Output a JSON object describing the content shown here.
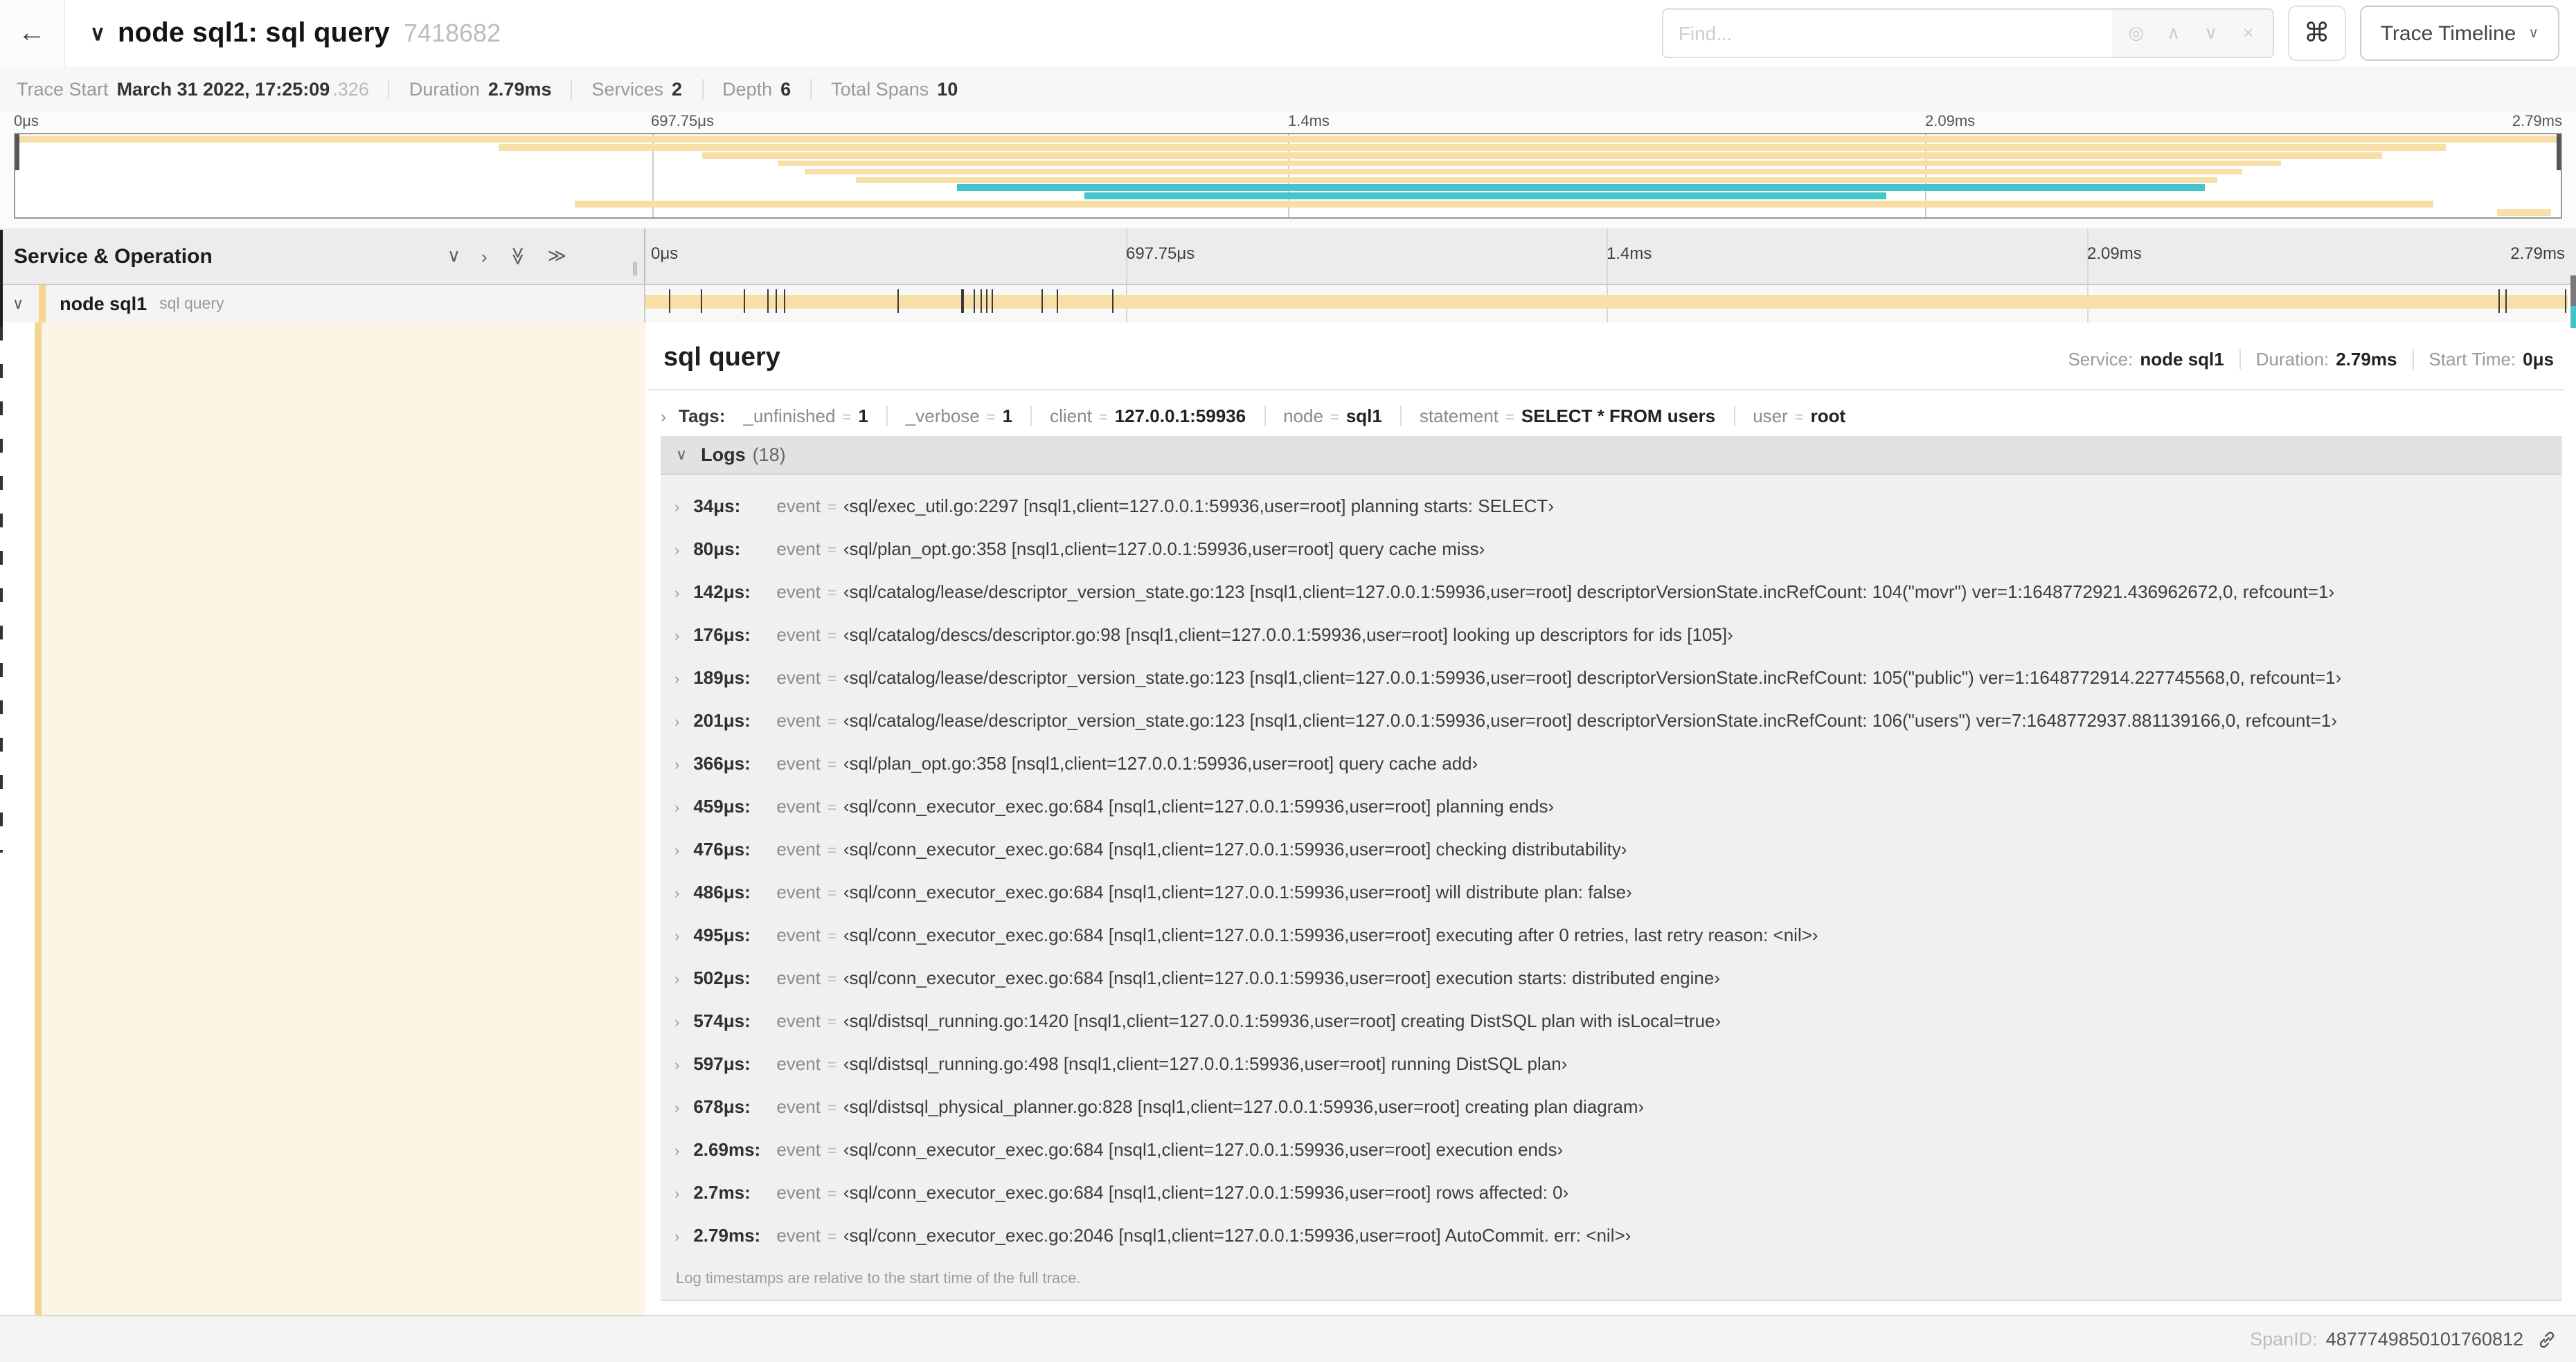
{
  "header": {
    "title": "node sql1: sql query",
    "trace_id": "7418682",
    "find_placeholder": "Find...",
    "view_select_label": "Trace Timeline"
  },
  "icons": {
    "back": "←",
    "title_chevron": "∨",
    "locate": "◎",
    "prev": "∧",
    "next": "∨",
    "clear": "×",
    "command": "⌘",
    "dropdown_chevron": "∨",
    "collapse_one": "∨",
    "expand_one": "›",
    "double_chevron": "≫",
    "row_chevron": "∨",
    "item_chevron": "›",
    "resizer": "∥"
  },
  "trace_info": {
    "items": [
      {
        "label": "Trace Start",
        "value": "March 31 2022, 17:25:09",
        "suffix": ".326"
      },
      {
        "label": "Duration",
        "value": "2.79ms",
        "suffix": ""
      },
      {
        "label": "Services",
        "value": "2",
        "suffix": ""
      },
      {
        "label": "Depth",
        "value": "6",
        "suffix": ""
      },
      {
        "label": "Total Spans",
        "value": "10",
        "suffix": ""
      }
    ]
  },
  "timeline": {
    "ticks": [
      "0μs",
      "697.75μs",
      "1.4ms",
      "2.09ms",
      "2.79ms"
    ],
    "tick_pcts": [
      0,
      25,
      50,
      75,
      100
    ],
    "colors": {
      "tan": "#f7dfa7",
      "teal": "#45c5c9",
      "accent": "#f4d591",
      "cream": "#fcf4e4"
    },
    "minimap_rows": [
      {
        "color": "tan",
        "start": 0,
        "end": 100
      },
      {
        "color": "tan",
        "start": 19,
        "end": 95.5
      },
      {
        "color": "tan",
        "start": 27,
        "end": 93
      },
      {
        "color": "tan",
        "start": 30,
        "end": 89
      },
      {
        "color": "tan",
        "start": 31,
        "end": 87.5
      },
      {
        "color": "tan",
        "start": 33,
        "end": 86.5
      },
      {
        "color": "teal",
        "start": 37,
        "end": 86
      },
      {
        "color": "teal",
        "start": 42,
        "end": 73.5
      },
      {
        "color": "tan",
        "start": 22,
        "end": 95
      },
      {
        "color": "tan",
        "start": 97.5,
        "end": 99.6
      }
    ],
    "span_ticks_pct": [
      1.22,
      2.87,
      5.09,
      6.31,
      6.78,
      7.2,
      13.12,
      16.45,
      17.06,
      17.42,
      17.74,
      17.99,
      20.57,
      21.4,
      24.3,
      96.42,
      96.77,
      99.85
    ]
  },
  "span_list": {
    "header": "Service & Operation",
    "rows": [
      {
        "service": "node sql1",
        "operation": "sql query"
      }
    ]
  },
  "detail": {
    "title": "sql query",
    "meta": [
      {
        "label": "Service:",
        "value": "node sql1"
      },
      {
        "label": "Duration:",
        "value": "2.79ms"
      },
      {
        "label": "Start Time:",
        "value": "0μs"
      }
    ],
    "tags_label": "Tags:",
    "tags": [
      {
        "key": "_unfinished",
        "value": "1"
      },
      {
        "key": "_verbose",
        "value": "1"
      },
      {
        "key": "client",
        "value": "127.0.0.1:59936"
      },
      {
        "key": "node",
        "value": "sql1"
      },
      {
        "key": "statement",
        "value": "SELECT * FROM users"
      },
      {
        "key": "user",
        "value": "root"
      }
    ],
    "logs_label": "Logs",
    "logs_count": "(18)",
    "logs": [
      {
        "time": "34μs:",
        "key": "event",
        "value": "‹sql/exec_util.go:2297 [nsql1,client=127.0.0.1:59936,user=root] planning starts: SELECT›"
      },
      {
        "time": "80μs:",
        "key": "event",
        "value": "‹sql/plan_opt.go:358 [nsql1,client=127.0.0.1:59936,user=root] query cache miss›"
      },
      {
        "time": "142μs:",
        "key": "event",
        "value": "‹sql/catalog/lease/descriptor_version_state.go:123 [nsql1,client=127.0.0.1:59936,user=root] descriptorVersionState.incRefCount: 104(\"movr\") ver=1:1648772921.436962672,0, refcount=1›"
      },
      {
        "time": "176μs:",
        "key": "event",
        "value": "‹sql/catalog/descs/descriptor.go:98 [nsql1,client=127.0.0.1:59936,user=root] looking up descriptors for ids [105]›"
      },
      {
        "time": "189μs:",
        "key": "event",
        "value": "‹sql/catalog/lease/descriptor_version_state.go:123 [nsql1,client=127.0.0.1:59936,user=root] descriptorVersionState.incRefCount: 105(\"public\") ver=1:1648772914.227745568,0, refcount=1›"
      },
      {
        "time": "201μs:",
        "key": "event",
        "value": "‹sql/catalog/lease/descriptor_version_state.go:123 [nsql1,client=127.0.0.1:59936,user=root] descriptorVersionState.incRefCount: 106(\"users\") ver=7:1648772937.881139166,0, refcount=1›"
      },
      {
        "time": "366μs:",
        "key": "event",
        "value": "‹sql/plan_opt.go:358 [nsql1,client=127.0.0.1:59936,user=root] query cache add›"
      },
      {
        "time": "459μs:",
        "key": "event",
        "value": "‹sql/conn_executor_exec.go:684 [nsql1,client=127.0.0.1:59936,user=root] planning ends›"
      },
      {
        "time": "476μs:",
        "key": "event",
        "value": "‹sql/conn_executor_exec.go:684 [nsql1,client=127.0.0.1:59936,user=root] checking distributability›"
      },
      {
        "time": "486μs:",
        "key": "event",
        "value": "‹sql/conn_executor_exec.go:684 [nsql1,client=127.0.0.1:59936,user=root] will distribute plan: false›"
      },
      {
        "time": "495μs:",
        "key": "event",
        "value": "‹sql/conn_executor_exec.go:684 [nsql1,client=127.0.0.1:59936,user=root] executing after 0 retries, last retry reason: <nil>›"
      },
      {
        "time": "502μs:",
        "key": "event",
        "value": "‹sql/conn_executor_exec.go:684 [nsql1,client=127.0.0.1:59936,user=root] execution starts: distributed engine›"
      },
      {
        "time": "574μs:",
        "key": "event",
        "value": "‹sql/distsql_running.go:1420 [nsql1,client=127.0.0.1:59936,user=root] creating DistSQL plan with isLocal=true›"
      },
      {
        "time": "597μs:",
        "key": "event",
        "value": "‹sql/distsql_running.go:498 [nsql1,client=127.0.0.1:59936,user=root] running DistSQL plan›"
      },
      {
        "time": "678μs:",
        "key": "event",
        "value": "‹sql/distsql_physical_planner.go:828 [nsql1,client=127.0.0.1:59936,user=root] creating plan diagram›"
      },
      {
        "time": "2.69ms:",
        "key": "event",
        "value": "‹sql/conn_executor_exec.go:684 [nsql1,client=127.0.0.1:59936,user=root] execution ends›"
      },
      {
        "time": "2.7ms:",
        "key": "event",
        "value": "‹sql/conn_executor_exec.go:684 [nsql1,client=127.0.0.1:59936,user=root] rows affected: 0›"
      },
      {
        "time": "2.79ms:",
        "key": "event",
        "value": "‹sql/conn_executor_exec.go:2046 [nsql1,client=127.0.0.1:59936,user=root] AutoCommit. err: <nil>›"
      }
    ],
    "logs_note": "Log timestamps are relative to the start time of the full trace.",
    "span_id_label": "SpanID:",
    "span_id": "4877749850101760812"
  }
}
